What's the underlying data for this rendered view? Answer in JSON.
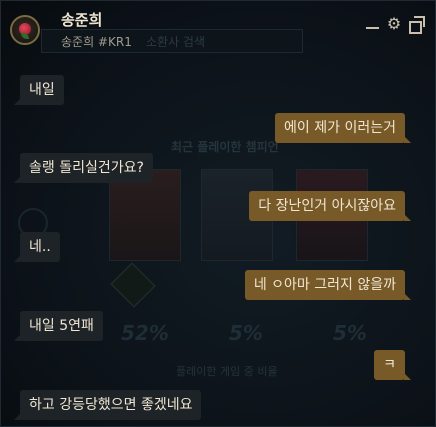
{
  "header": {
    "name": "송준희",
    "tag": "송준희 #KR1"
  },
  "background": {
    "search_placeholder": "소환사 검색",
    "section_title": "최근 플레이한 챔피언",
    "percents": [
      "52%",
      "5%",
      "5%"
    ],
    "caption": "플레이한 게임 중 비율"
  },
  "messages": [
    {
      "side": "in",
      "text": "내일"
    },
    {
      "side": "out",
      "text": "에이 제가 이러는거"
    },
    {
      "side": "in",
      "text": "솔랭 돌리실건가요?"
    },
    {
      "side": "out",
      "text": "다 장난인거 아시잖아요"
    },
    {
      "side": "in",
      "text": "네.."
    },
    {
      "side": "out",
      "text": "네 ㅇ아마 그러지 않을까"
    },
    {
      "side": "in",
      "text": "내일 5연패"
    },
    {
      "side": "out",
      "text": "ㅋ"
    },
    {
      "side": "in",
      "text": "하고 강등당했으면 좋겠네요"
    }
  ],
  "colors": {
    "incoming_bubble": "#1e2328",
    "outgoing_bubble": "#785a28",
    "text": "#f0e6d2"
  }
}
